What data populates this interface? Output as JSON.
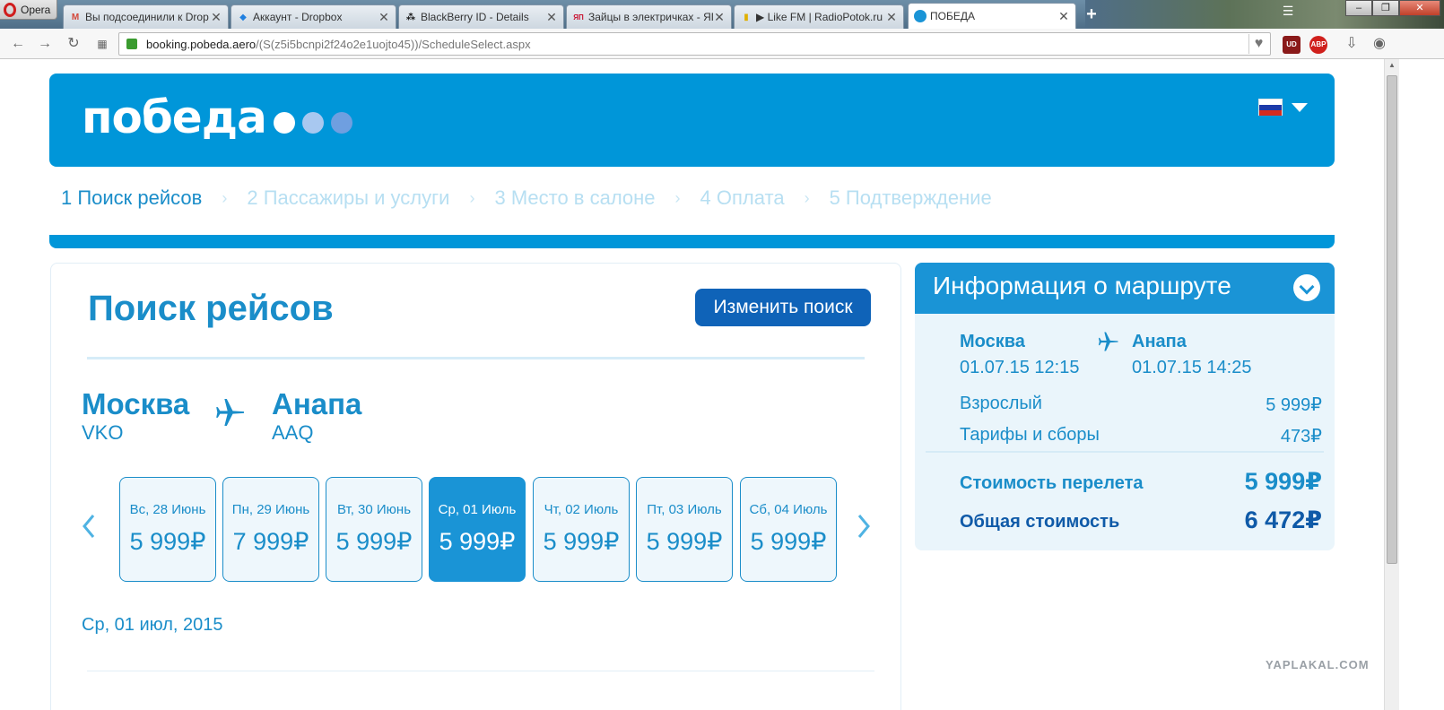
{
  "browser": {
    "opera_label": "Opera",
    "tabs": [
      {
        "label": "Вы подсоединили к Drop",
        "icon": "gmail-icon"
      },
      {
        "label": "Аккаунт - Dropbox",
        "icon": "dropbox-icon"
      },
      {
        "label": "BlackBerry ID - Details",
        "icon": "blackberry-icon"
      },
      {
        "label": "Зайцы в электричках - ЯП",
        "icon": "yap-icon"
      },
      {
        "label": "▶ Like FM | RadioPotok.ru",
        "icon": "radio-icon"
      },
      {
        "label": "ПОБЕДА",
        "icon": "pobeda-icon"
      }
    ],
    "url_host": "booking.pobeda.aero",
    "url_path": "/(S(z5i5bcnpi2f24o2e1uojto45))/ScheduleSelect.aspx",
    "ext_ud": "UD",
    "ext_abp": "ABP"
  },
  "site": {
    "logo": "победа",
    "logo_dot_colors": [
      "#ffffff",
      "#a8c8f0",
      "#6f9fe0"
    ],
    "steps": [
      "1 Поиск рейсов",
      "2 Пассажиры и услуги",
      "3 Место в салоне",
      "4 Оплата",
      "5 Подтверждение"
    ]
  },
  "search": {
    "title": "Поиск рейсов",
    "change_button": "Изменить поиск",
    "from_city": "Москва",
    "from_code": "VKO",
    "to_city": "Анапа",
    "to_code": "AAQ",
    "days": [
      {
        "label": "Вс, 28 Июнь",
        "price": "5 999₽",
        "selected": false
      },
      {
        "label": "Пн, 29 Июнь",
        "price": "7 999₽",
        "selected": false
      },
      {
        "label": "Вт, 30 Июнь",
        "price": "5 999₽",
        "selected": false
      },
      {
        "label": "Ср, 01 Июль",
        "price": "5 999₽",
        "selected": true
      },
      {
        "label": "Чт, 02 Июль",
        "price": "5 999₽",
        "selected": false
      },
      {
        "label": "Пт, 03 Июль",
        "price": "5 999₽",
        "selected": false
      },
      {
        "label": "Сб, 04 Июль",
        "price": "5 999₽",
        "selected": false
      }
    ],
    "selected_date": "Ср, 01 июл, 2015"
  },
  "route_info": {
    "title": "Информация о маршруте",
    "from_city": "Москва",
    "from_time": "01.07.15 12:15",
    "to_city": "Анапа",
    "to_time": "01.07.15 14:25",
    "adult_label": "Взрослый",
    "adult_price": "5 999₽",
    "fees_label": "Тарифы и сборы",
    "fees_price": "473₽",
    "flight_cost_label": "Стоимость перелета",
    "flight_cost": "5 999₽",
    "total_label": "Общая стоимость",
    "total": "6 472₽"
  },
  "watermark": "YAPLAKAL.COM"
}
